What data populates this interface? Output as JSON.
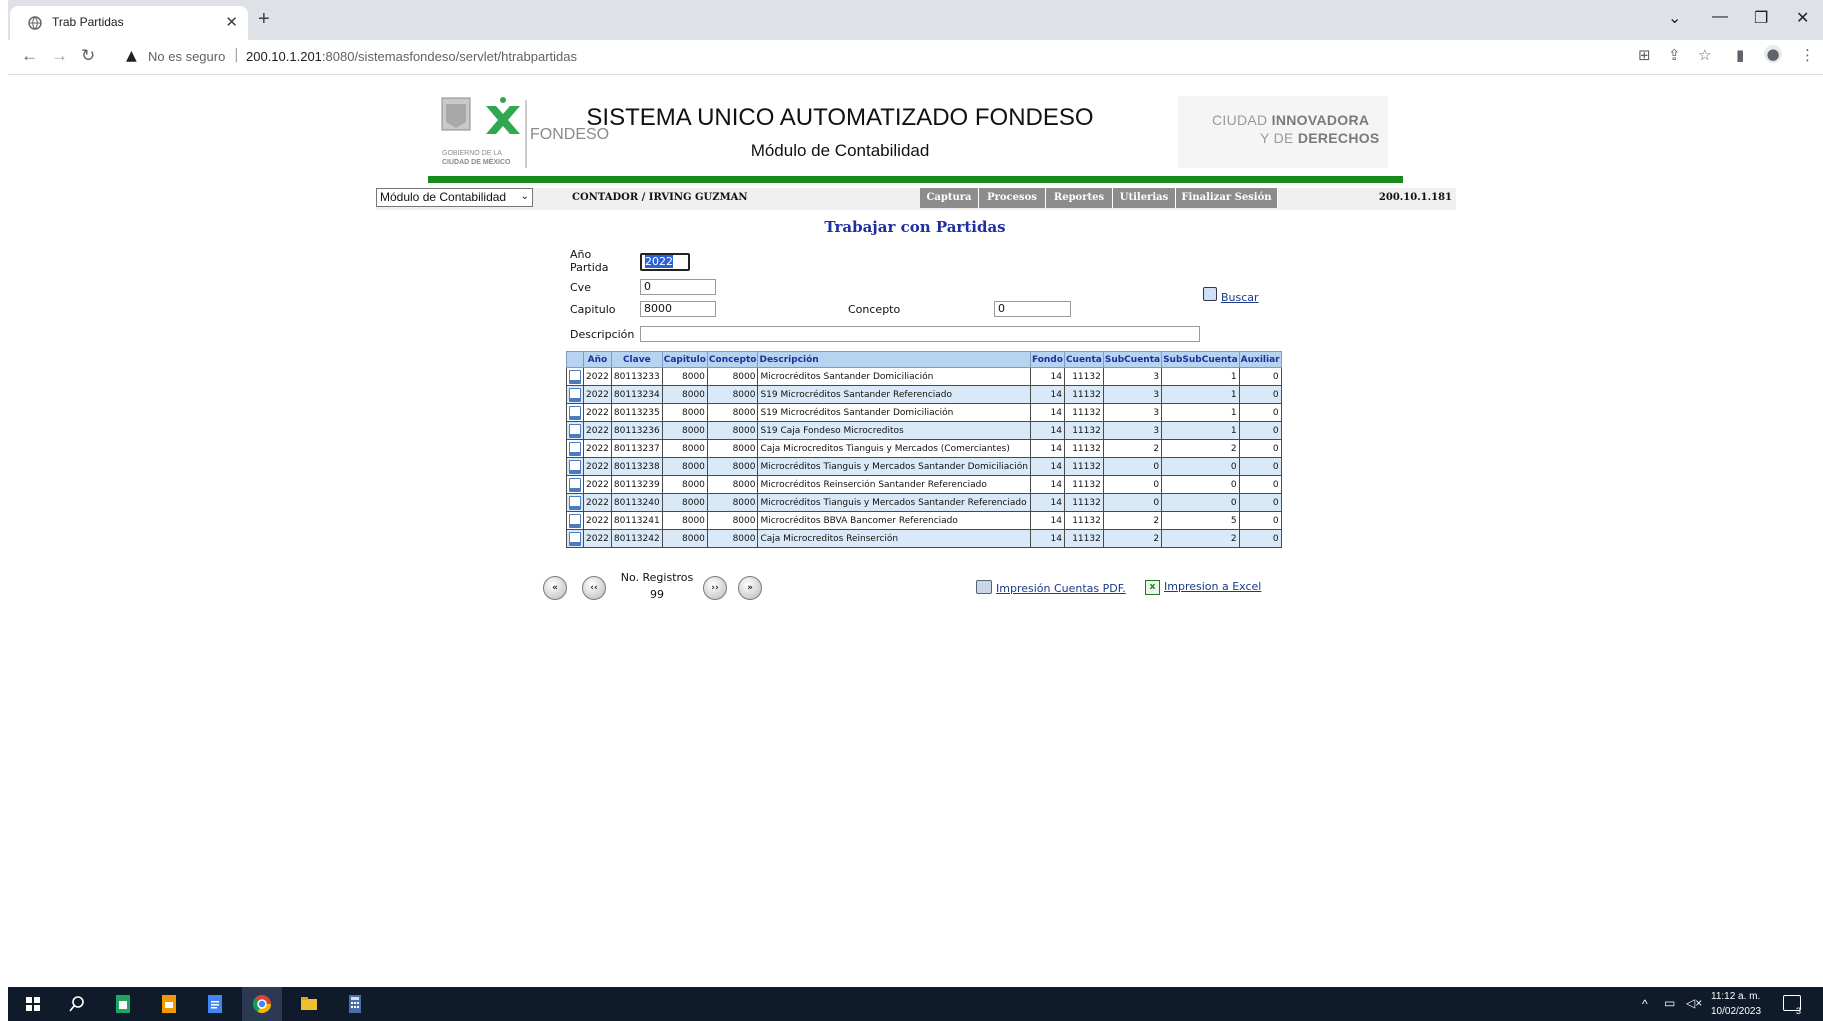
{
  "browser": {
    "tab_title": "Trab Partidas",
    "tab_close": "✕",
    "new_tab": "+",
    "not_secure": "No es seguro",
    "url_host": "200.10.1.201",
    "url_path": ":8080/sistemasfondeso/servlet/htrabpartidas"
  },
  "header": {
    "logo_text": "FONDESO",
    "logo_caption_1": "GOBIERNO DE LA",
    "logo_caption_2": "CIUDAD DE MÉXICO",
    "title": "SISTEMA UNICO AUTOMATIZADO FONDESO",
    "subtitle": "Módulo de Contabilidad",
    "cdmx_a": "CIUDAD ",
    "cdmx_b": "INNOVADORA",
    "cdmx_c": "Y DE ",
    "cdmx_d": "DERECHOS"
  },
  "menu": {
    "module_selected": "Módulo de Contabilidad",
    "user": "CONTADOR / IRVING GUZMAN",
    "items": [
      "Captura",
      "Procesos",
      "Reportes",
      "Utilerias",
      "Finalizar Sesión"
    ],
    "ip": "200.10.1.181"
  },
  "page": {
    "title": "Trabajar con Partidas"
  },
  "form": {
    "anio_label_1": "Año",
    "anio_label_2": "Partida",
    "anio_value": "2022",
    "cve_label": "Cve",
    "cve_value": "0",
    "capitulo_label": "Capitulo",
    "capitulo_value": "8000",
    "concepto_label": "Concepto",
    "concepto_value": "0",
    "descripcion_label": "Descripción",
    "descripcion_value": "",
    "search_label": "Buscar"
  },
  "table": {
    "headers": [
      "Año",
      "Clave",
      "Capitulo",
      "Concepto",
      "Descripción",
      "Fondo",
      "Cuenta",
      "SubCuenta",
      "SubSubCuenta",
      "Auxiliar"
    ],
    "rows": [
      [
        "2022",
        "80113233",
        "8000",
        "8000",
        "Microcréditos Santander Domiciliación",
        "14",
        "11132",
        "3",
        "1",
        "0"
      ],
      [
        "2022",
        "80113234",
        "8000",
        "8000",
        "S19 Microcréditos Santander Referenciado",
        "14",
        "11132",
        "3",
        "1",
        "0"
      ],
      [
        "2022",
        "80113235",
        "8000",
        "8000",
        "S19 Microcréditos Santander Domiciliación",
        "14",
        "11132",
        "3",
        "1",
        "0"
      ],
      [
        "2022",
        "80113236",
        "8000",
        "8000",
        "S19 Caja Fondeso Microcreditos",
        "14",
        "11132",
        "3",
        "1",
        "0"
      ],
      [
        "2022",
        "80113237",
        "8000",
        "8000",
        "Caja Microcreditos Tianguis y Mercados (Comerciantes)",
        "14",
        "11132",
        "2",
        "2",
        "0"
      ],
      [
        "2022",
        "80113238",
        "8000",
        "8000",
        "Microcréditos Tianguis y Mercados Santander Domiciliación",
        "14",
        "11132",
        "0",
        "0",
        "0"
      ],
      [
        "2022",
        "80113239",
        "8000",
        "8000",
        "Microcréditos Reinserción Santander Referenciado",
        "14",
        "11132",
        "0",
        "0",
        "0"
      ],
      [
        "2022",
        "80113240",
        "8000",
        "8000",
        "Microcréditos Tianguis y Mercados Santander Referenciado",
        "14",
        "11132",
        "0",
        "0",
        "0"
      ],
      [
        "2022",
        "80113241",
        "8000",
        "8000",
        "Microcréditos BBVA Bancomer Referenciado",
        "14",
        "11132",
        "2",
        "5",
        "0"
      ],
      [
        "2022",
        "80113242",
        "8000",
        "8000",
        "Caja Microcreditos Reinserción",
        "14",
        "11132",
        "2",
        "2",
        "0"
      ]
    ]
  },
  "pager": {
    "records_label": "No. Registros",
    "records_count": "99",
    "first": "«",
    "prev": "‹‹",
    "next": "››",
    "last": "»"
  },
  "exports": {
    "pdf_label": "Impresión Cuentas PDF.",
    "excel_label": "Impresion a Excel"
  },
  "taskbar": {
    "time": "11:12 a. m.",
    "date": "10/02/2023",
    "notifications": "3"
  },
  "colors": {
    "accent_green": "#1a8a1a",
    "title_blue": "#1e2fa0",
    "header_row_blue": "#b8d3ef",
    "alt_row_blue": "#d9e9f7",
    "menu_gray": "#8c8c8c"
  }
}
